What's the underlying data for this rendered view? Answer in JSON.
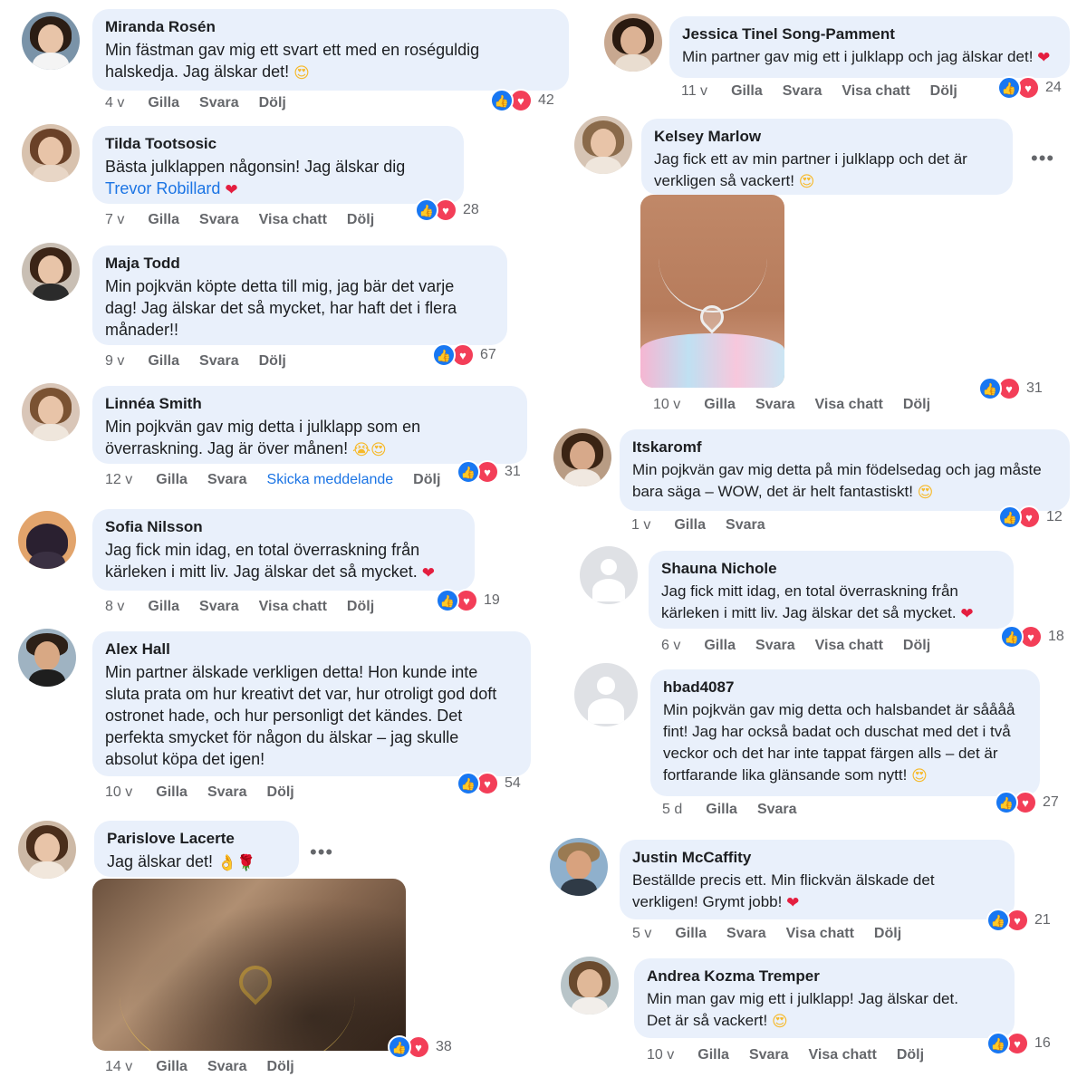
{
  "reactions": {
    "like_icon": "thumbs-up",
    "love_icon": "heart",
    "like_color": "#1877f2",
    "love_color": "#f33e58"
  },
  "left_column": [
    {
      "author": "Miranda Rosén",
      "text": "Min fästman gav mig ett svart ett med en roséguldig halskedja. Jag älskar det!",
      "emoji": [
        "😍"
      ],
      "time": "4 v",
      "actions": [
        "Gilla",
        "Svara",
        "Dölj"
      ],
      "reaction_count": "42"
    },
    {
      "author": "Tilda Tootsosic",
      "text": "Bästa julklappen någonsin! Jag älskar dig",
      "mention": "Trevor Robillard",
      "emoji": [
        "❤"
      ],
      "time": "7 v",
      "actions": [
        "Gilla",
        "Svara",
        "Visa chatt",
        "Dölj"
      ],
      "reaction_count": "28"
    },
    {
      "author": "Maja Todd",
      "text": "Min pojkvän köpte detta till mig, jag bär det varje dag! Jag älskar det så mycket, har haft det i flera månader!!",
      "time": "9 v",
      "actions": [
        "Gilla",
        "Svara",
        "Dölj"
      ],
      "reaction_count": "67"
    },
    {
      "author": "Linnéa Smith",
      "text": "Min pojkvän gav mig detta i julklapp som en överraskning. Jag är över månen!",
      "emoji": [
        "😭",
        "😍"
      ],
      "time": "12 v",
      "actions": [
        "Gilla",
        "Svara",
        "Skicka meddelande",
        "Dölj"
      ],
      "reaction_count": "31"
    },
    {
      "author": "Sofia Nilsson",
      "text": "Jag fick min idag, en total överraskning från kärleken i mitt liv. Jag älskar det så mycket.",
      "emoji": [
        "❤"
      ],
      "time": "8 v",
      "actions": [
        "Gilla",
        "Svara",
        "Visa chatt",
        "Dölj"
      ],
      "reaction_count": "19"
    },
    {
      "author": "Alex Hall",
      "text": "Min partner älskade verkligen detta! Hon kunde inte sluta prata om hur kreativt det var, hur otroligt god doft ostronet hade, och hur personligt det kändes. Det perfekta smycket för någon du älskar – jag skulle absolut köpa det igen!",
      "time": "10 v",
      "actions": [
        "Gilla",
        "Svara",
        "Dölj"
      ],
      "reaction_count": "54"
    },
    {
      "author": "Parislove Lacerte",
      "text": "Jag älskar det!",
      "emoji": [
        "👌",
        "🌹"
      ],
      "time": "14 v",
      "actions": [
        "Gilla",
        "Svara",
        "Dölj"
      ],
      "reaction_count": "38"
    }
  ],
  "right_column": [
    {
      "author": "Jessica Tinel Song-Pamment",
      "text": "Min partner gav mig ett i julklapp och jag älskar det!",
      "emoji": [
        "❤"
      ],
      "time": "11 v",
      "actions": [
        "Gilla",
        "Svara",
        "Visa chatt",
        "Dölj"
      ],
      "reaction_count": "24"
    },
    {
      "author": "Kelsey Marlow",
      "text": "Jag fick ett av min partner i julklapp och det är verkligen så vackert!",
      "emoji": [
        "😍"
      ],
      "time": "10 v",
      "actions": [
        "Gilla",
        "Svara",
        "Visa chatt",
        "Dölj"
      ],
      "reaction_count": "31"
    },
    {
      "author": "Itskaromf",
      "text": "Min pojkvän gav mig detta på min födelsedag och jag måste bara säga – WOW, det är helt fantastiskt!",
      "emoji": [
        "😍"
      ],
      "time": "1 v",
      "actions": [
        "Gilla",
        "Svara"
      ],
      "reaction_count": "12"
    },
    {
      "author": "Shauna Nichole",
      "text": "Jag fick mitt idag, en total överraskning från kärleken i mitt liv. Jag älskar det så mycket.",
      "emoji": [
        "❤"
      ],
      "time": "6 v",
      "actions": [
        "Gilla",
        "Svara",
        "Visa chatt",
        "Dölj"
      ],
      "reaction_count": "18"
    },
    {
      "author": "hbad4087",
      "text": "Min pojkvän gav mig detta och halsbandet är såååå fint! Jag har också badat och duschat med det i två veckor och det har inte tappat färgen alls – det är fortfarande lika glänsande som nytt!",
      "emoji": [
        "😍"
      ],
      "time": "5 d",
      "actions": [
        "Gilla",
        "Svara"
      ],
      "reaction_count": "27"
    },
    {
      "author": "Justin McCaffity",
      "text": "Beställde precis ett. Min flickvän älskade det verkligen! Grymt jobb!",
      "emoji": [
        "❤"
      ],
      "time": "5 v",
      "actions": [
        "Gilla",
        "Svara",
        "Visa chatt",
        "Dölj"
      ],
      "reaction_count": "21"
    },
    {
      "author": "Andrea Kozma Tremper",
      "text": "Min man gav mig ett i julklapp! Jag älskar det. Det är så vackert!",
      "emoji": [
        "😍"
      ],
      "time": "10 v",
      "actions": [
        "Gilla",
        "Svara",
        "Visa chatt",
        "Dölj"
      ],
      "reaction_count": "16"
    }
  ]
}
